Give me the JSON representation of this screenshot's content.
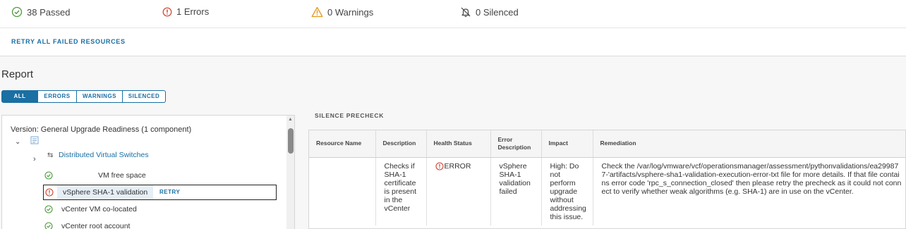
{
  "summary": {
    "passed": "38 Passed",
    "errors": "1 Errors",
    "warnings": "0 Warnings",
    "silenced": "0 Silenced",
    "retry_all": "RETRY ALL FAILED RESOURCES"
  },
  "report": {
    "title": "Report",
    "filters": [
      "ALL",
      "ERRORS",
      "WARNINGS",
      "SILENCED"
    ]
  },
  "tree": {
    "version": "Version: General Upgrade Readiness (1 component)",
    "group": "Distributed Virtual Switches",
    "checks": [
      {
        "label": "VM free space",
        "status": "passed"
      },
      {
        "label": "vSphere SHA-1 validation",
        "status": "error",
        "action": "RETRY"
      },
      {
        "label": "vCenter VM co-located",
        "status": "passed"
      },
      {
        "label": "vCenter root account",
        "status": "passed"
      }
    ]
  },
  "silence_label": "SILENCE PRECHECK",
  "table": {
    "headers": [
      "Resource Name",
      "Description",
      "Health Status",
      "Error Description",
      "Impact",
      "Remediation"
    ],
    "rows": [
      {
        "resource": "",
        "description": "Checks if SHA-1 certificate is present in the vCenter",
        "health": "ERROR",
        "error_description": "vSphere SHA-1 validation failed",
        "impact": "High: Do not perform upgrade without addressing this issue.",
        "remediation": "Check the /var/log/vmware/vcf/operationsmanager/assessment/pythonvalidations/ea299877-'artifacts/vsphere-sha1-validation-execution-error-txt file for more details. If that file contains error code 'rpc_s_connection_closed' then please retry the precheck as it could not connect to verify whether weak algorithms (e.g. SHA-1) are in use on the vCenter."
      }
    ]
  },
  "colors": {
    "accent": "#1a6fa3",
    "success": "#4d9b3a",
    "error": "#d0412f",
    "warning": "#e29a1f"
  }
}
